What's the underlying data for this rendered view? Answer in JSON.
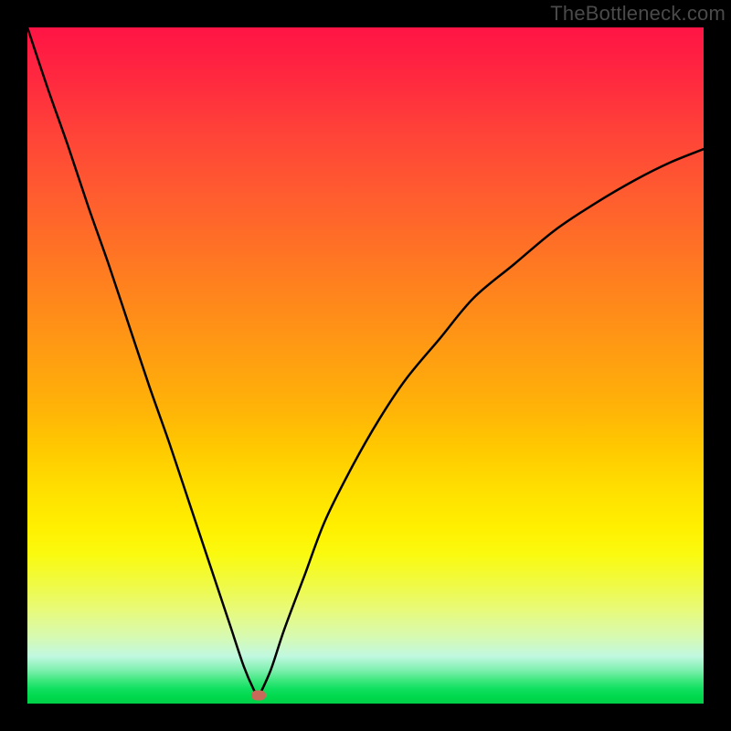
{
  "watermark": "TheBottleneck.com",
  "marker": {
    "x_pct": 34.2,
    "y_pct": 98.8
  },
  "chart_data": {
    "type": "line",
    "title": "",
    "xlabel": "",
    "ylabel": "",
    "xlim": [
      0,
      100
    ],
    "ylim": [
      0,
      100
    ],
    "grid": false,
    "legend": null,
    "note": "Two curve branches forming a V shape with minimum near x≈34. Values estimated from pixel positions; axes are unlabeled.",
    "series": [
      {
        "name": "left-branch",
        "x": [
          0,
          3,
          6,
          9,
          12,
          15,
          18,
          21,
          24,
          27,
          30,
          32,
          33.5,
          34.2
        ],
        "values": [
          100,
          91,
          82.5,
          73.5,
          65,
          56,
          47,
          38.5,
          29.5,
          20.5,
          11.5,
          5.5,
          2,
          1
        ]
      },
      {
        "name": "right-branch",
        "x": [
          34.2,
          36,
          38,
          41,
          44,
          48,
          52,
          56,
          61,
          66,
          72,
          78,
          84,
          90,
          95,
          100
        ],
        "values": [
          1,
          5,
          11,
          19,
          27,
          35,
          42,
          48,
          54,
          60,
          65,
          70,
          74,
          77.5,
          80,
          82
        ]
      }
    ],
    "background_gradient": {
      "direction": "vertical",
      "stops": [
        {
          "pct": 0,
          "color": "#ff1445"
        },
        {
          "pct": 50,
          "color": "#ffb000"
        },
        {
          "pct": 75,
          "color": "#fff000"
        },
        {
          "pct": 95,
          "color": "#80f0b0"
        },
        {
          "pct": 100,
          "color": "#00d048"
        }
      ]
    },
    "marker": {
      "x": 34.2,
      "y": 1.2,
      "color": "#c86a5a"
    }
  }
}
